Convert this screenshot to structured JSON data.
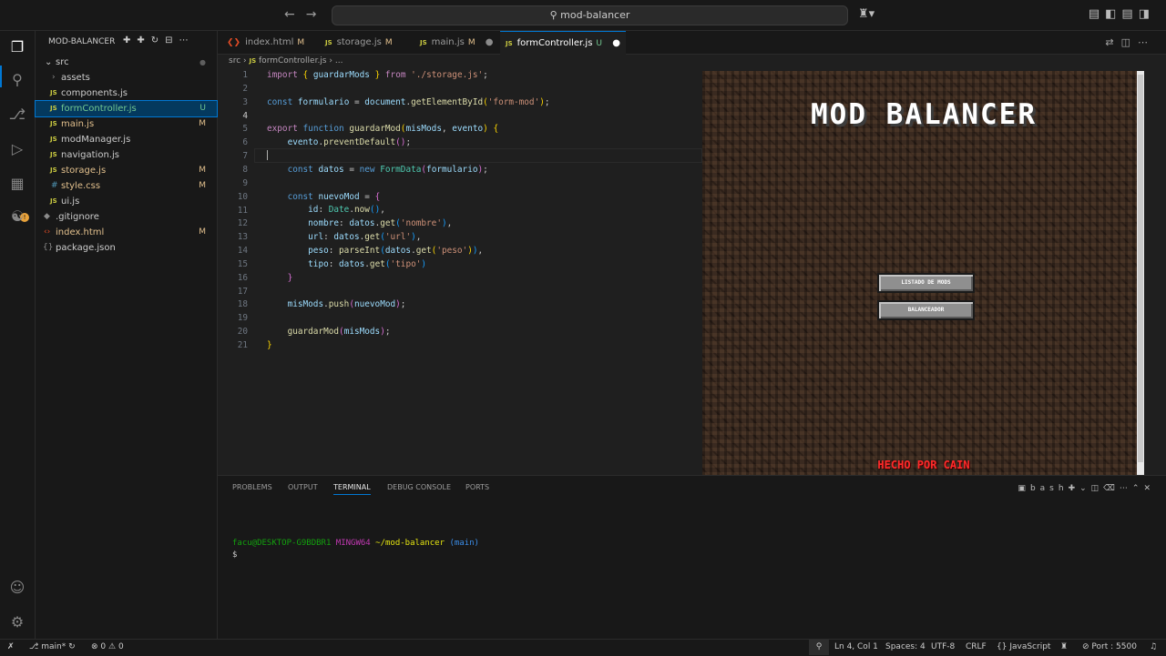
{
  "titlebar": {
    "search_text": "mod-balancer",
    "back_icon": "arrow-left-icon",
    "forward_icon": "arrow-right-icon"
  },
  "explorer": {
    "title": "MOD-BALANCER",
    "folder": "src",
    "items": [
      {
        "name": "assets",
        "type": "folder",
        "status": ""
      },
      {
        "name": "components.js",
        "type": "js",
        "status": ""
      },
      {
        "name": "formController.js",
        "type": "js",
        "status": "U"
      },
      {
        "name": "main.js",
        "type": "js",
        "status": "M"
      },
      {
        "name": "modManager.js",
        "type": "js",
        "status": ""
      },
      {
        "name": "navigation.js",
        "type": "js",
        "status": ""
      },
      {
        "name": "storage.js",
        "type": "js",
        "status": "M"
      },
      {
        "name": "style.css",
        "type": "css",
        "status": "M"
      },
      {
        "name": "ui.js",
        "type": "js",
        "status": ""
      },
      {
        "name": ".gitignore",
        "type": "git",
        "status": ""
      },
      {
        "name": "index.html",
        "type": "html",
        "status": "M"
      },
      {
        "name": "package.json",
        "type": "json",
        "status": ""
      }
    ]
  },
  "tabs": [
    {
      "label": "index.html",
      "status": "M"
    },
    {
      "label": "storage.js",
      "status": "M"
    },
    {
      "label": "main.js",
      "status": "M"
    },
    {
      "label": "formController.js",
      "status": "U"
    }
  ],
  "breadcrumb": {
    "folder": "src",
    "file": "formController.js",
    "more": "..."
  },
  "code": {
    "lines": [
      "1",
      "2",
      "3",
      "4",
      "5",
      "6",
      "7",
      "8",
      "9",
      "10",
      "11",
      "12",
      "13",
      "14",
      "15",
      "16",
      "17",
      "18",
      "19",
      "20",
      "21"
    ],
    "current_line": "4"
  },
  "preview": {
    "title": "MOD BALANCER",
    "buttons": [
      "LISTADO DE MODS",
      "BALANCEADOR"
    ],
    "footer": "HECHO POR CAIN"
  },
  "panel": {
    "tabs": [
      "PROBLEMS",
      "OUTPUT",
      "TERMINAL",
      "DEBUG CONSOLE",
      "PORTS"
    ],
    "active_tab": "TERMINAL",
    "shell": "bash",
    "terminal": {
      "user": "facu@DESKTOP-G9BDBR1",
      "host": "MINGW64",
      "path": "~/mod-balancer",
      "branch": "(main)",
      "prompt": "$"
    }
  },
  "status": {
    "branch": "main*",
    "errors": "0",
    "warnings": "0",
    "position": "Ln 4, Col 1",
    "spaces": "Spaces: 4",
    "encoding": "UTF-8",
    "eol": "CRLF",
    "language": "JavaScript",
    "port": "Port : 5500"
  },
  "colors": {
    "accent": "#0078d4",
    "modified": "#e2c08d",
    "untracked": "#73c991"
  }
}
